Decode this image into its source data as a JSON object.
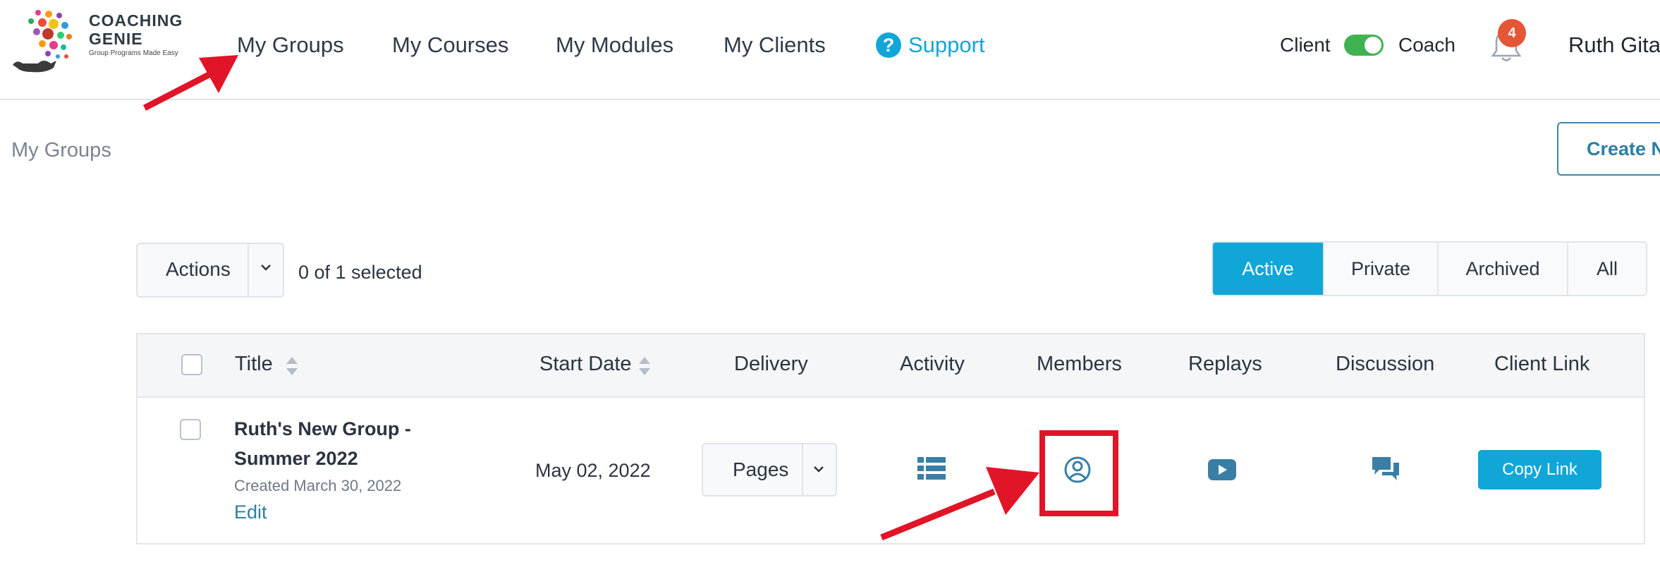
{
  "brand": {
    "name_line1": "COACHING",
    "name_line2": "GENIE",
    "tagline": "Group Programs Made Easy"
  },
  "nav": {
    "items": [
      "My Groups",
      "My Courses",
      "My Modules",
      "My Clients"
    ],
    "support_label": "Support"
  },
  "role_toggle": {
    "left_label": "Client",
    "right_label": "Coach",
    "state": "Coach",
    "color": "#3fb34f"
  },
  "notifications": {
    "count": "4",
    "badge_color": "#e45635"
  },
  "user": {
    "name": "Ruth Gitau"
  },
  "page": {
    "title": "My Groups",
    "create_label": "Create New Group"
  },
  "toolbar": {
    "actions_label": "Actions",
    "selected_text": "0 of 1 selected"
  },
  "filters": {
    "options": [
      "Active",
      "Private",
      "Archived",
      "All"
    ],
    "active": "Active",
    "active_color": "#10a6d8"
  },
  "table": {
    "headers": {
      "title": "Title",
      "start_date": "Start Date",
      "delivery": "Delivery",
      "activity": "Activity",
      "members": "Members",
      "replays": "Replays",
      "discussion": "Discussion",
      "client_link": "Client Link"
    },
    "rows": [
      {
        "title_line1": "Ruth's New Group -",
        "title_line2": "Summer 2022",
        "created": "Created March 30, 2022",
        "edit_label": "Edit",
        "start_date": "May 02, 2022",
        "delivery": "Pages",
        "copy_label": "Copy Link"
      }
    ]
  },
  "icons": {
    "activity": "list-icon",
    "members": "user-circle-icon",
    "replays": "youtube-play-icon",
    "discussion": "chat-bubbles-icon",
    "accent_color": "#3a7ea5"
  },
  "annotations": {
    "highlight_color": "#e11428"
  }
}
